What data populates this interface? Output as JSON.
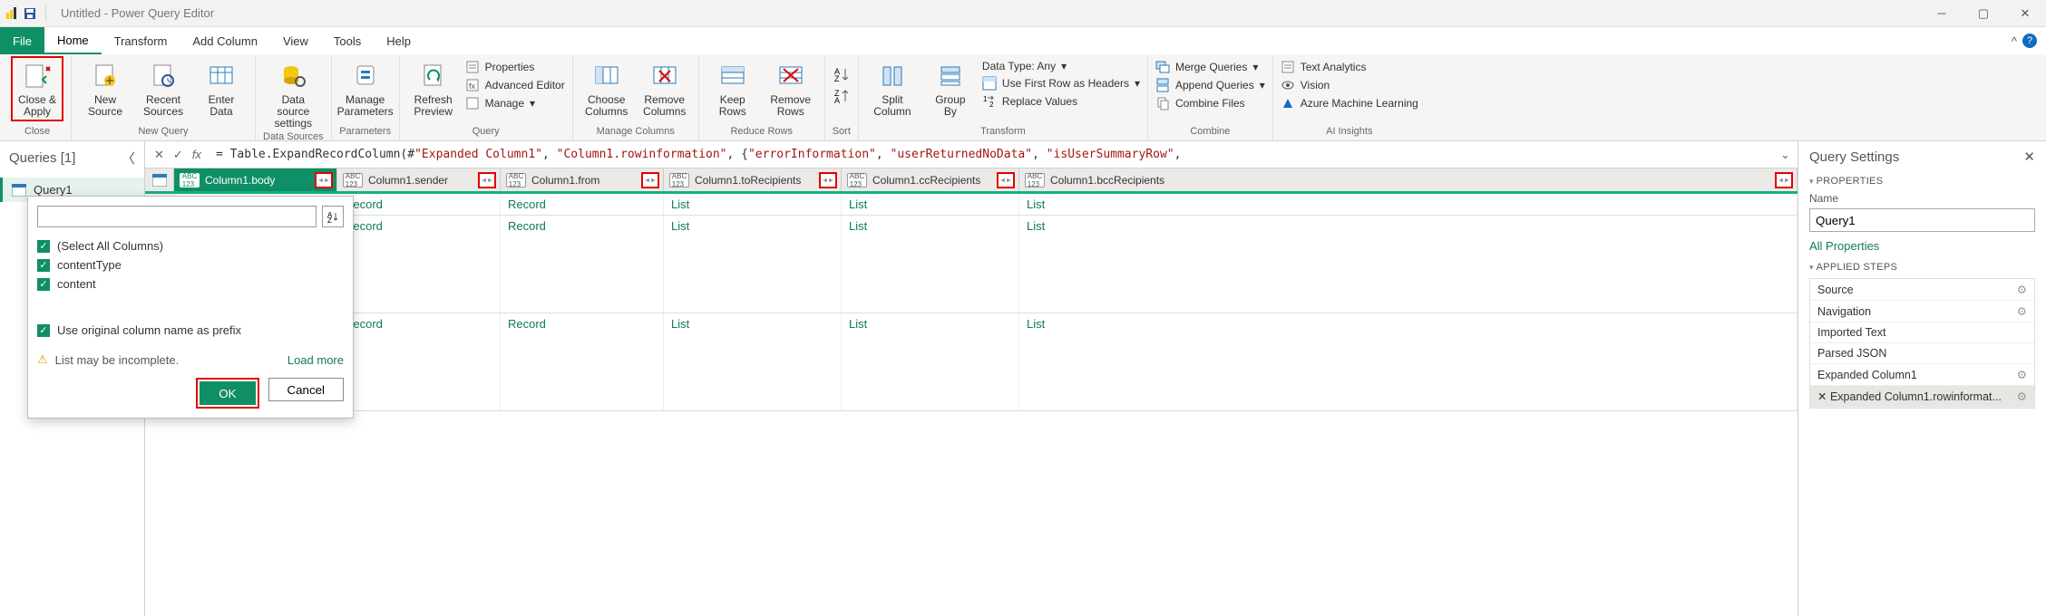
{
  "title": "Untitled - Power Query Editor",
  "tabs": {
    "file": "File",
    "home": "Home",
    "transform": "Transform",
    "addcol": "Add Column",
    "view": "View",
    "tools": "Tools",
    "help": "Help"
  },
  "ribbon": {
    "close": {
      "closeapply": "Close &\nApply",
      "group": "Close"
    },
    "newquery": {
      "newsource": "New\nSource",
      "recent": "Recent\nSources",
      "enter": "Enter\nData",
      "group": "New Query"
    },
    "datasources": {
      "btn": "Data source\nsettings",
      "group": "Data Sources"
    },
    "parameters": {
      "btn": "Manage\nParameters",
      "group": "Parameters"
    },
    "query": {
      "refresh": "Refresh\nPreview",
      "props": "Properties",
      "adv": "Advanced Editor",
      "manage": "Manage",
      "group": "Query"
    },
    "mcols": {
      "choose": "Choose\nColumns",
      "remove": "Remove\nColumns",
      "group": "Manage Columns"
    },
    "rrows": {
      "keep": "Keep\nRows",
      "remove": "Remove\nRows",
      "group": "Reduce Rows"
    },
    "sort": {
      "group": "Sort"
    },
    "split": {
      "split": "Split\nColumn",
      "groupby": "Group\nBy",
      "datatype": "Data Type: Any",
      "firstrow": "Use First Row as Headers",
      "replace": "Replace Values",
      "group": "Transform"
    },
    "combine": {
      "merge": "Merge Queries",
      "append": "Append Queries",
      "combine": "Combine Files",
      "group": "Combine"
    },
    "ai": {
      "text": "Text Analytics",
      "vision": "Vision",
      "azml": "Azure Machine Learning",
      "group": "AI Insights"
    }
  },
  "queries": {
    "header": "Queries [1]",
    "q1": "Query1"
  },
  "formula": "= Table.ExpandRecordColumn(#\"Expanded Column1\", \"Column1.rowinformation\", {\"errorInformation\", \"userReturnedNoData\", \"isUserSummaryRow\",",
  "formula_parts": {
    "a": "= Table.ExpandRecordColumn(#",
    "b": "\"Expanded Column1\"",
    "c": ", ",
    "d": "\"Column1.rowinformation\"",
    "e": ", {",
    "f": "\"errorInformation\"",
    "g": ", ",
    "h": "\"userReturnedNoData\"",
    "i": ", ",
    "j": "\"isUserSummaryRow\"",
    "k": ","
  },
  "columns": [
    "Column1.body",
    "Column1.sender",
    "Column1.from",
    "Column1.toRecipients",
    "Column1.ccRecipients",
    "Column1.bccRecipients"
  ],
  "celltypes": [
    "Record",
    "Record",
    "Record",
    "List",
    "List",
    "List"
  ],
  "popup": {
    "search_placeholder": "",
    "items": [
      "(Select All Columns)",
      "contentType",
      "content"
    ],
    "prefix": "Use original column name as prefix",
    "warn": "List may be incomplete.",
    "loadmore": "Load more",
    "ok": "OK",
    "cancel": "Cancel"
  },
  "settings": {
    "header": "Query Settings",
    "properties": "PROPERTIES",
    "namelabel": "Name",
    "name": "Query1",
    "allprops": "All Properties",
    "applied": "APPLIED STEPS",
    "steps": [
      "Source",
      "Navigation",
      "Imported Text",
      "Parsed JSON",
      "Expanded Column1",
      "Expanded Column1.rowinformat..."
    ]
  }
}
